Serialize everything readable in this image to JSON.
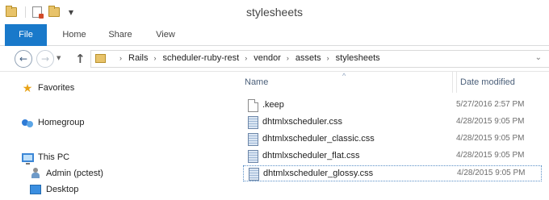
{
  "window": {
    "title": "stylesheets"
  },
  "ribbon": {
    "tabs": [
      {
        "label": "File"
      },
      {
        "label": "Home"
      },
      {
        "label": "Share"
      },
      {
        "label": "View"
      }
    ]
  },
  "address": {
    "breadcrumbs": [
      "Rails",
      "scheduler-ruby-rest",
      "vendor",
      "assets",
      "stylesheets"
    ],
    "separator": "›"
  },
  "nav_pane": {
    "items": [
      {
        "label": "Favorites",
        "icon": "star-icon"
      },
      {
        "label": "Homegroup",
        "icon": "homegroup-icon"
      },
      {
        "label": "This PC",
        "icon": "computer-icon"
      },
      {
        "label": "Admin (pctest)",
        "icon": "user-icon"
      },
      {
        "label": "Desktop",
        "icon": "desktop-folder-icon"
      }
    ]
  },
  "file_list": {
    "columns": {
      "name": "Name",
      "date_modified": "Date modified"
    },
    "files": [
      {
        "name": ".keep",
        "date": "5/27/2016 2:57 PM",
        "type": "blank-file-icon"
      },
      {
        "name": "dhtmlxscheduler.css",
        "date": "4/28/2015 9:05 PM",
        "type": "css-file-icon"
      },
      {
        "name": "dhtmlxscheduler_classic.css",
        "date": "4/28/2015 9:05 PM",
        "type": "css-file-icon"
      },
      {
        "name": "dhtmlxscheduler_flat.css",
        "date": "4/28/2015 9:05 PM",
        "type": "css-file-icon"
      },
      {
        "name": "dhtmlxscheduler_glossy.css",
        "date": "4/28/2015 9:05 PM",
        "type": "css-file-icon",
        "selected": true
      }
    ]
  },
  "colors": {
    "file_tab": "#1979ca",
    "header_text": "#4c607a"
  }
}
